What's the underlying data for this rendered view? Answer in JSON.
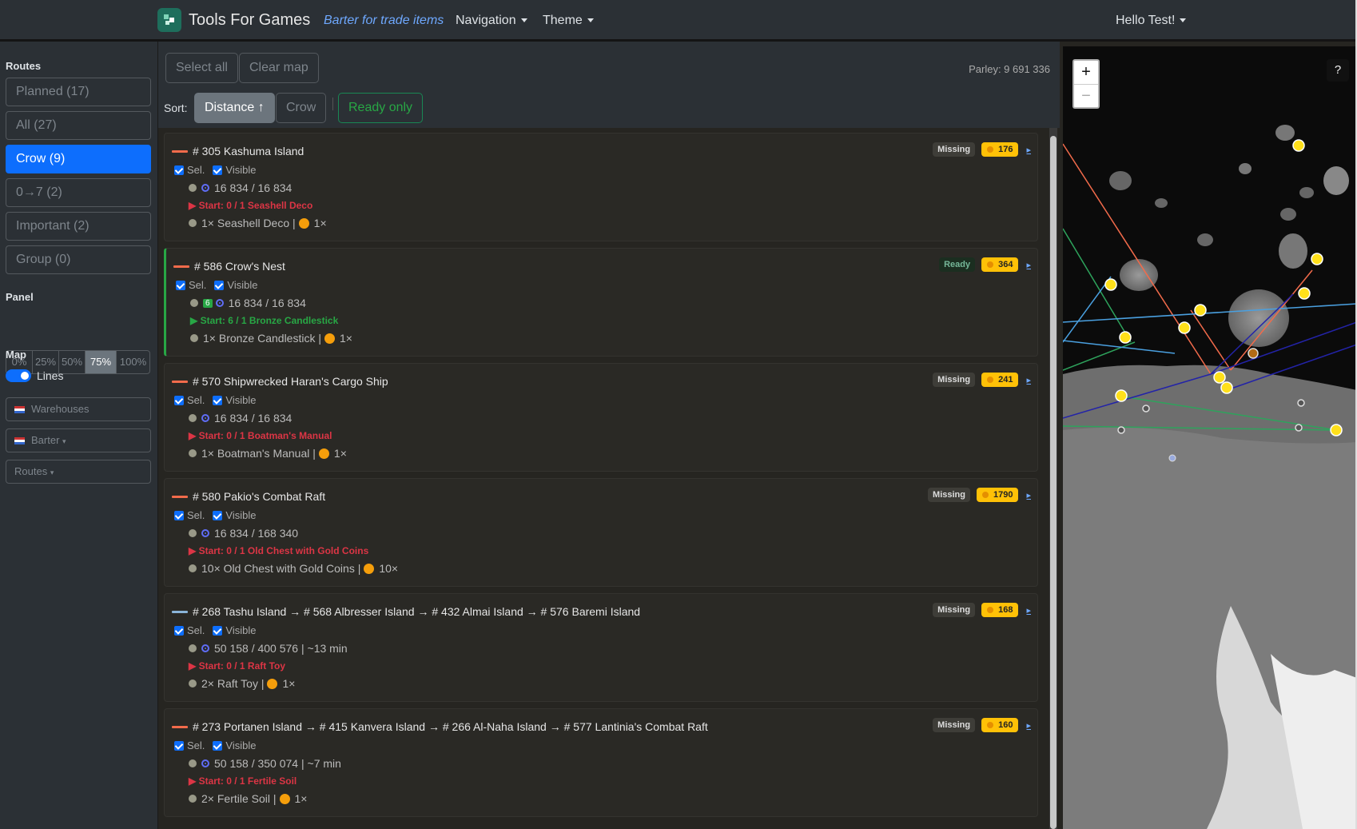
{
  "navbar": {
    "brand": "Tools For Games",
    "subtitle": "Barter for trade items",
    "navigation": "Navigation",
    "theme": "Theme",
    "user": "Hello Test!"
  },
  "sidebar": {
    "routes_title": "Routes",
    "routes": [
      {
        "label": "Planned (17)",
        "active": false
      },
      {
        "label": "All (27)",
        "active": false
      },
      {
        "label": "Crow (9)",
        "active": true
      },
      {
        "label": "0→7 (2)",
        "active": false
      },
      {
        "label": "Important (2)",
        "active": false
      },
      {
        "label": "Group (0)",
        "active": false
      }
    ],
    "panel_title": "Panel",
    "panel_options": [
      "0%",
      "25%",
      "50%",
      "75%",
      "100%"
    ],
    "panel_selected": "75%",
    "map_title": "Map",
    "lines_label": "Lines",
    "lines_on": true,
    "warehouses": "Warehouses",
    "barter": "Barter",
    "routes_select": "Routes"
  },
  "toolbar": {
    "select_all": "Select all",
    "clear_map": "Clear map",
    "parley": "Parley: 9 691 336",
    "sort_label": "Sort:",
    "sort_distance": "Distance ↑",
    "sort_crow": "Crow",
    "ready_only": "Ready only"
  },
  "labels": {
    "sel": "Sel.",
    "visible": "Visible",
    "go": "▸"
  },
  "route_cards": [
    {
      "title": "# 305 Kashuma Island",
      "line_color": "#f26b4b",
      "status": "Missing",
      "gold": "176",
      "distance": "16 834 / 16 834",
      "badge": "",
      "start": "Start: 0 / 1 Seashell Deco",
      "start_state": "missing",
      "item": "1× Seashell Deco |",
      "reward": "1×"
    },
    {
      "title": "# 586 Crow's Nest",
      "line_color": "#f26b4b",
      "status": "Ready",
      "gold": "364",
      "distance": "16 834 / 16 834",
      "badge": "6",
      "start": "Start: 6 / 1 Bronze Candlestick",
      "start_state": "ready",
      "item": "1× Bronze Candlestick |",
      "reward": "1×"
    },
    {
      "title": "# 570 Shipwrecked Haran's Cargo Ship",
      "line_color": "#f26b4b",
      "status": "Missing",
      "gold": "241",
      "distance": "16 834 / 16 834",
      "badge": "",
      "start": "Start: 0 / 1 Boatman's Manual",
      "start_state": "missing",
      "item": "1× Boatman's Manual |",
      "reward": "1×"
    },
    {
      "title": "# 580 Pakio's Combat Raft",
      "line_color": "#f26b4b",
      "status": "Missing",
      "gold": "1790",
      "distance": "16 834 / 168 340",
      "badge": "",
      "start": "Start: 0 / 1 Old Chest with Gold Coins",
      "start_state": "missing",
      "item": "10× Old Chest with Gold Coins |",
      "reward": "10×"
    },
    {
      "title": "# 268 Tashu Island → # 568 Albresser Island → # 432 Almai Island → # 576 Baremi Island",
      "line_color": "#8ab4d8",
      "status": "Missing",
      "gold": "168",
      "distance": "50 158 / 400 576 | ~13 min",
      "badge": "",
      "start": "Start: 0 / 1 Raft Toy",
      "start_state": "missing",
      "item": "2× Raft Toy |",
      "reward": "1×"
    },
    {
      "title": "# 273 Portanen Island → # 415 Kanvera Island → # 266 Al-Naha Island → # 577 Lantinia's Combat Raft",
      "line_color": "#f26b4b",
      "status": "Missing",
      "gold": "160",
      "distance": "50 158 / 350 074 | ~7 min",
      "badge": "",
      "start": "Start: 0 / 1 Fertile Soil",
      "start_state": "missing",
      "item": "2× Fertile Soil |",
      "reward": "1×"
    }
  ],
  "map": {
    "zoom_in": "+",
    "zoom_out": "−",
    "help": "?"
  }
}
